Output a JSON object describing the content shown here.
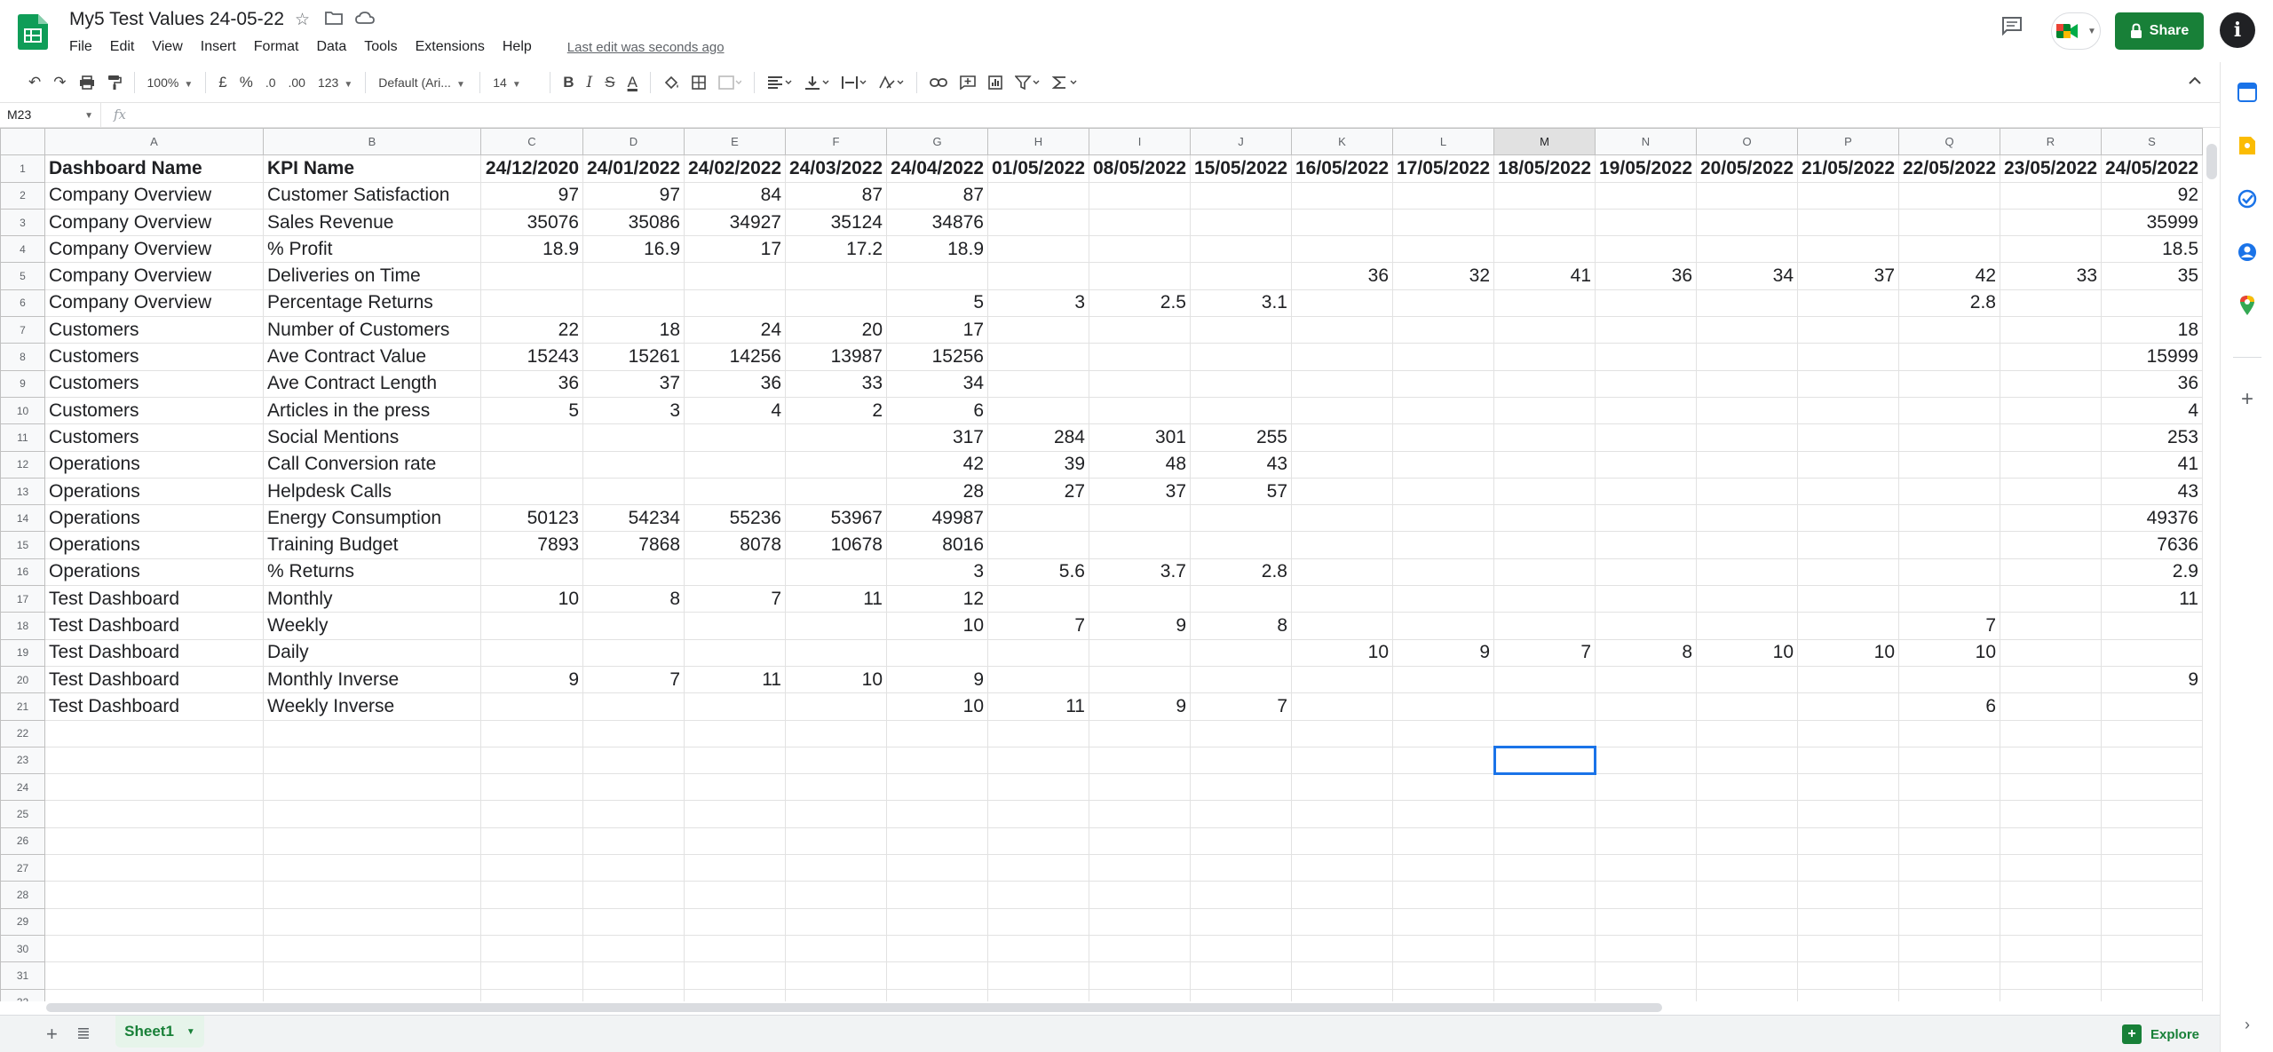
{
  "title": "My5 Test Values 24-05-22",
  "menu": [
    "File",
    "Edit",
    "View",
    "Insert",
    "Format",
    "Data",
    "Tools",
    "Extensions",
    "Help"
  ],
  "last_edit": "Last edit was seconds ago",
  "share_label": "Share",
  "account_initial": "i",
  "toolbar": {
    "zoom": "100%",
    "currency": "£",
    "percent": "%",
    "decrease_decimal": ".0",
    "increase_decimal": ".00",
    "more_formats": "123",
    "font": "Default (Ari...",
    "font_size": "14"
  },
  "name_box": "M23",
  "fx": "fx",
  "selected_cell": "M23",
  "selected_col": "M",
  "columns": [
    "A",
    "B",
    "C",
    "D",
    "E",
    "F",
    "G",
    "H",
    "I",
    "J",
    "K",
    "L",
    "M",
    "N",
    "O",
    "P",
    "Q",
    "R",
    "S"
  ],
  "rows": [
    [
      "Dashboard Name",
      "KPI Name",
      "24/12/2020",
      "24/01/2022",
      "24/02/2022",
      "24/03/2022",
      "24/04/2022",
      "01/05/2022",
      "08/05/2022",
      "15/05/2022",
      "16/05/2022",
      "17/05/2022",
      "18/05/2022",
      "19/05/2022",
      "20/05/2022",
      "21/05/2022",
      "22/05/2022",
      "23/05/2022",
      "24/05/2022"
    ],
    [
      "Company Overview",
      "Customer Satisfaction",
      "97",
      "97",
      "84",
      "87",
      "87",
      "",
      "",
      "",
      "",
      "",
      "",
      "",
      "",
      "",
      "",
      "",
      "92"
    ],
    [
      "Company Overview",
      "Sales Revenue",
      "35076",
      "35086",
      "34927",
      "35124",
      "34876",
      "",
      "",
      "",
      "",
      "",
      "",
      "",
      "",
      "",
      "",
      "",
      "35999"
    ],
    [
      "Company Overview",
      "% Profit",
      "18.9",
      "16.9",
      "17",
      "17.2",
      "18.9",
      "",
      "",
      "",
      "",
      "",
      "",
      "",
      "",
      "",
      "",
      "",
      "18.5"
    ],
    [
      "Company Overview",
      "Deliveries on Time",
      "",
      "",
      "",
      "",
      "",
      "",
      "",
      "",
      "36",
      "32",
      "41",
      "36",
      "34",
      "37",
      "42",
      "33",
      "35"
    ],
    [
      "Company Overview",
      "Percentage Returns",
      "",
      "",
      "",
      "",
      "5",
      "3",
      "2.5",
      "3.1",
      "",
      "",
      "",
      "",
      "",
      "",
      "2.8",
      "",
      ""
    ],
    [
      "Customers",
      "Number of Customers",
      "22",
      "18",
      "24",
      "20",
      "17",
      "",
      "",
      "",
      "",
      "",
      "",
      "",
      "",
      "",
      "",
      "",
      "18"
    ],
    [
      "Customers",
      "Ave Contract Value",
      "15243",
      "15261",
      "14256",
      "13987",
      "15256",
      "",
      "",
      "",
      "",
      "",
      "",
      "",
      "",
      "",
      "",
      "",
      "15999"
    ],
    [
      "Customers",
      "Ave Contract Length",
      "36",
      "37",
      "36",
      "33",
      "34",
      "",
      "",
      "",
      "",
      "",
      "",
      "",
      "",
      "",
      "",
      "",
      "36"
    ],
    [
      "Customers",
      "Articles in the press",
      "5",
      "3",
      "4",
      "2",
      "6",
      "",
      "",
      "",
      "",
      "",
      "",
      "",
      "",
      "",
      "",
      "",
      "4"
    ],
    [
      "Customers",
      "Social Mentions",
      "",
      "",
      "",
      "",
      "317",
      "284",
      "301",
      "255",
      "",
      "",
      "",
      "",
      "",
      "",
      "",
      "",
      "253"
    ],
    [
      "Operations",
      "Call Conversion rate",
      "",
      "",
      "",
      "",
      "42",
      "39",
      "48",
      "43",
      "",
      "",
      "",
      "",
      "",
      "",
      "",
      "",
      "41"
    ],
    [
      "Operations",
      "Helpdesk Calls",
      "",
      "",
      "",
      "",
      "28",
      "27",
      "37",
      "57",
      "",
      "",
      "",
      "",
      "",
      "",
      "",
      "",
      "43"
    ],
    [
      "Operations",
      "Energy Consumption",
      "50123",
      "54234",
      "55236",
      "53967",
      "49987",
      "",
      "",
      "",
      "",
      "",
      "",
      "",
      "",
      "",
      "",
      "",
      "49376"
    ],
    [
      "Operations",
      "Training Budget",
      "7893",
      "7868",
      "8078",
      "10678",
      "8016",
      "",
      "",
      "",
      "",
      "",
      "",
      "",
      "",
      "",
      "",
      "",
      "7636"
    ],
    [
      "Operations",
      "% Returns",
      "",
      "",
      "",
      "",
      "3",
      "5.6",
      "3.7",
      "2.8",
      "",
      "",
      "",
      "",
      "",
      "",
      "",
      "",
      "2.9"
    ],
    [
      "Test Dashboard",
      "Monthly",
      "10",
      "8",
      "7",
      "11",
      "12",
      "",
      "",
      "",
      "",
      "",
      "",
      "",
      "",
      "",
      "",
      "",
      "11"
    ],
    [
      "Test Dashboard",
      "Weekly",
      "",
      "",
      "",
      "",
      "10",
      "7",
      "9",
      "8",
      "",
      "",
      "",
      "",
      "",
      "",
      "7",
      "",
      ""
    ],
    [
      "Test Dashboard",
      "Daily",
      "",
      "",
      "",
      "",
      "",
      "",
      "",
      "",
      "10",
      "9",
      "7",
      "8",
      "10",
      "10",
      "10",
      "",
      ""
    ],
    [
      "Test Dashboard",
      "Monthly Inverse",
      "9",
      "7",
      "11",
      "10",
      "9",
      "",
      "",
      "",
      "",
      "",
      "",
      "",
      "",
      "",
      "",
      "",
      "9"
    ],
    [
      "Test Dashboard",
      "Weekly Inverse",
      "",
      "",
      "",
      "",
      "10",
      "11",
      "9",
      "7",
      "",
      "",
      "",
      "",
      "",
      "",
      "6",
      "",
      ""
    ]
  ],
  "empty_row_count": 14,
  "sheet_tab": "Sheet1",
  "explore_label": "Explore"
}
